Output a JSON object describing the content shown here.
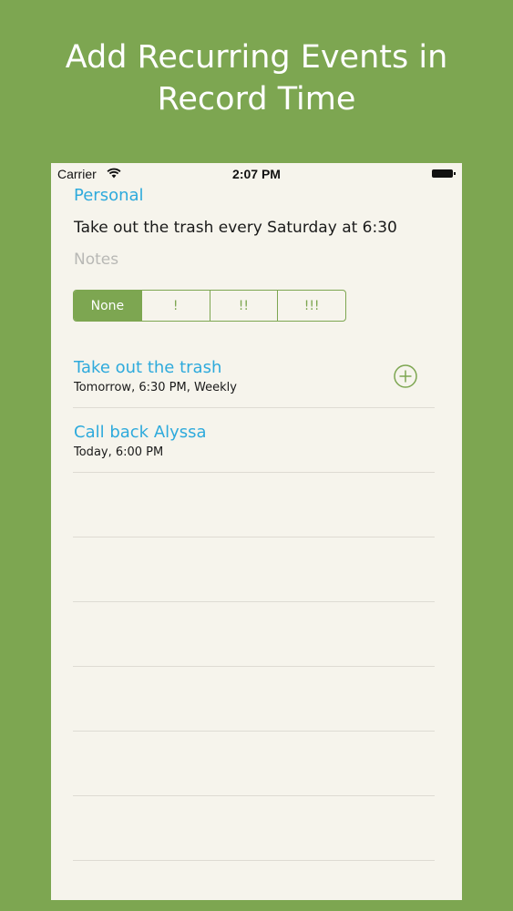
{
  "headline": {
    "line1": "Add Recurring Events in",
    "line2": "Record Time"
  },
  "status_bar": {
    "carrier": "Carrier",
    "time": "2:07 PM",
    "wifi_icon": "wifi-icon",
    "battery_icon": "battery-icon"
  },
  "list_name": "Personal",
  "task_input": {
    "value": "Take out the trash every Saturday at 6:30"
  },
  "notes_input": {
    "placeholder": "Notes"
  },
  "priority": {
    "options": [
      "None",
      "!",
      "!!",
      "!!!"
    ],
    "selected": "None"
  },
  "tasks": [
    {
      "title": "Take out the trash",
      "subtitle": "Tomorrow, 6:30 PM, Weekly",
      "action_icon": "add-circle-icon"
    },
    {
      "title": "Call back Alyssa",
      "subtitle": "Today, 6:00 PM"
    }
  ],
  "colors": {
    "background": "#7da651",
    "accent": "#7da651",
    "link_blue": "#2eaadc",
    "paper": "#f6f4ec"
  }
}
